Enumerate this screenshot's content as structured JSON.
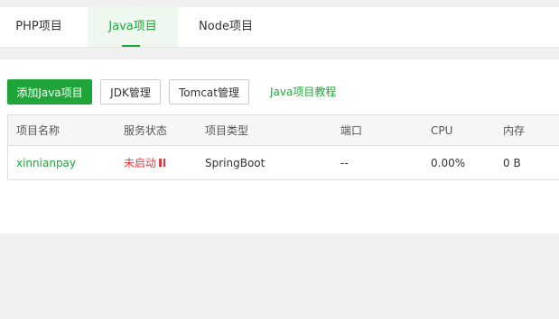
{
  "tabs": [
    {
      "label": "PHP项目",
      "active": false
    },
    {
      "label": "Java项目",
      "active": true
    },
    {
      "label": "Node项目",
      "active": false
    }
  ],
  "toolbar": {
    "add_label": "添加Java项目",
    "jdk_label": "JDK管理",
    "tomcat_label": "Tomcat管理",
    "tutorial_label": "Java项目教程"
  },
  "table": {
    "headers": [
      "项目名称",
      "服务状态",
      "项目类型",
      "端口",
      "CPU",
      "内存"
    ],
    "rows": [
      {
        "name": "xinnianpay",
        "status": "未启动",
        "status_icon": "pause-icon",
        "type": "SpringBoot",
        "port": "--",
        "cpu": "0.00%",
        "memory": "0 B"
      }
    ]
  },
  "colors": {
    "accent": "#20a53a",
    "stopped": "#e4393c"
  }
}
